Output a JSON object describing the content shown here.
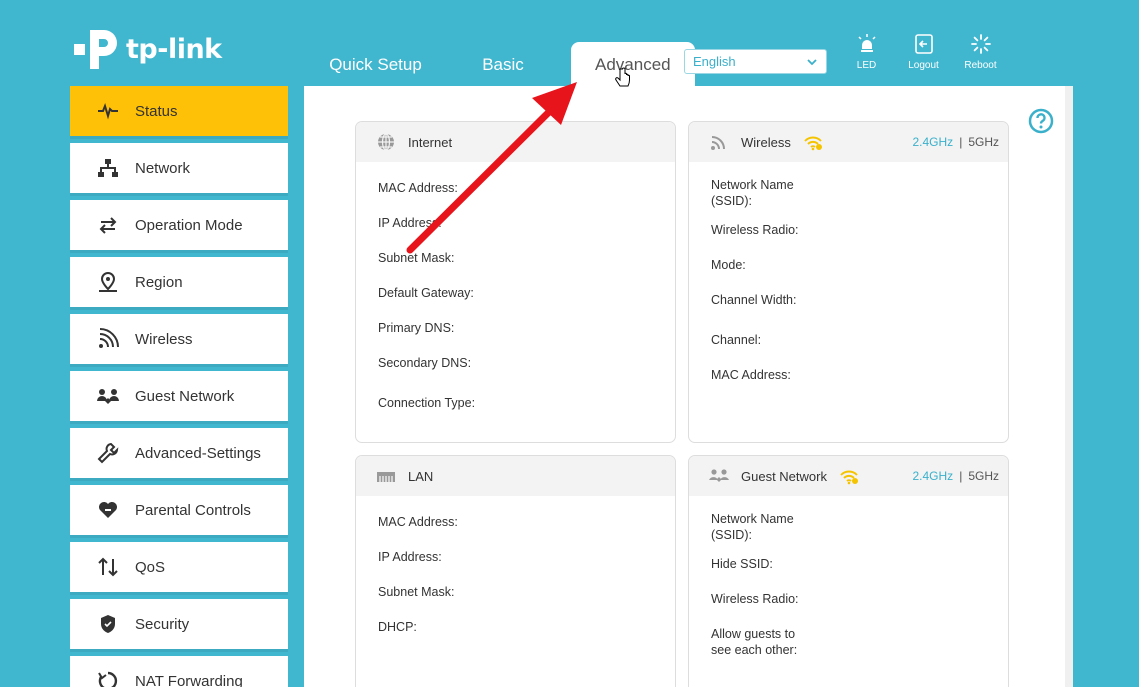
{
  "brand": {
    "logo_text": "tp-link"
  },
  "tabs": [
    {
      "label": "Quick Setup"
    },
    {
      "label": "Basic"
    },
    {
      "label": "Advanced"
    }
  ],
  "language": {
    "selected": "English"
  },
  "top_icons": [
    {
      "label": "LED",
      "icon": "lightbulb-icon"
    },
    {
      "label": "Logout",
      "icon": "logout-icon"
    },
    {
      "label": "Reboot",
      "icon": "reboot-icon"
    }
  ],
  "sidebar": {
    "items": [
      {
        "label": "Status",
        "icon": "pulse-icon",
        "active": true
      },
      {
        "label": "Network",
        "icon": "network-icon"
      },
      {
        "label": "Operation Mode",
        "icon": "swap-icon"
      },
      {
        "label": "Region",
        "icon": "location-pin-icon"
      },
      {
        "label": "Wireless",
        "icon": "wifi-signal-icon"
      },
      {
        "label": "Guest Network",
        "icon": "guests-icon"
      },
      {
        "label": "Advanced-Settings",
        "icon": "wrench-icon"
      },
      {
        "label": "Parental Controls",
        "icon": "heart-icon"
      },
      {
        "label": "QoS",
        "icon": "up-down-arrows-icon"
      },
      {
        "label": "Security",
        "icon": "shield-icon"
      },
      {
        "label": "NAT Forwarding",
        "icon": "nat-icon"
      }
    ]
  },
  "cards": {
    "internet": {
      "title": "Internet",
      "fields": [
        "MAC Address:",
        "IP Address:",
        "Subnet Mask:",
        "Default Gateway:",
        "Primary DNS:",
        "Secondary DNS:",
        "Connection Type:"
      ]
    },
    "wireless": {
      "title": "Wireless",
      "band_24": "2.4GHz",
      "separator": "|",
      "band_5": "5GHz",
      "fields": [
        "Network Name\n(SSID):",
        "Wireless Radio:",
        "Mode:",
        "Channel Width:",
        "Channel:",
        "MAC Address:"
      ]
    },
    "lan": {
      "title": "LAN",
      "fields": [
        "MAC Address:",
        "IP Address:",
        "Subnet Mask:",
        "DHCP:"
      ]
    },
    "guest": {
      "title": "Guest Network",
      "band_24": "2.4GHz",
      "separator": "|",
      "band_5": "5GHz",
      "fields": [
        "Network Name\n(SSID):",
        "Hide SSID:",
        "Wireless Radio:",
        "Allow guests to\nsee each other:"
      ]
    }
  },
  "colors": {
    "background": "#40b6cf",
    "active_nav": "#ffc107",
    "accent": "#3ab0cb",
    "wifi_yellow": "#f5c400",
    "arrow_red": "#e8141b"
  }
}
